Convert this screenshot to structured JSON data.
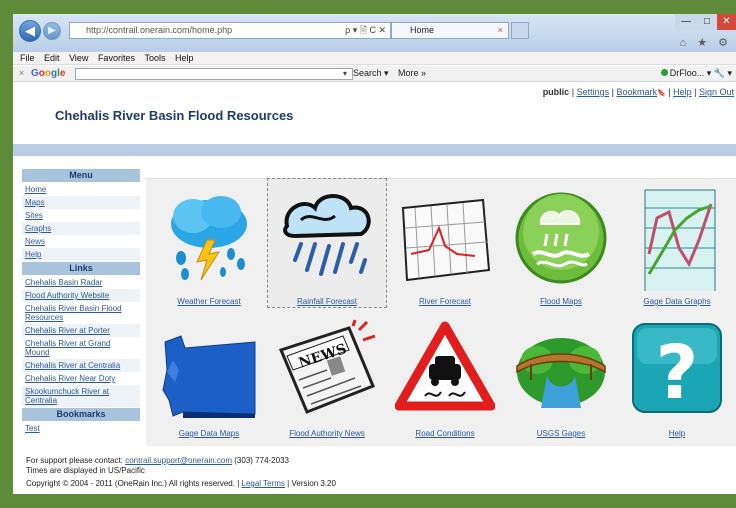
{
  "browser": {
    "url": "http://contrail.onerain.com/home.php",
    "addr_icons": "ρ ▾ 🗎 C ✕",
    "tab_title": "Home",
    "tab_close": "×",
    "back": "◀",
    "forward": "▶",
    "win_min": "—",
    "win_max": "□",
    "win_close": "✕",
    "tb_icons": "⌂ ★ ⚙"
  },
  "menubar": [
    "File",
    "Edit",
    "View",
    "Favorites",
    "Tools",
    "Help"
  ],
  "googlebar": {
    "close": "×",
    "logo": [
      "G",
      "o",
      "o",
      "g",
      "l",
      "e"
    ],
    "dropdown": "▾",
    "search_label": "Search ▾",
    "more_label": "More »",
    "user_label": "DrFloo... ▾",
    "wrench": "🔧 ▾"
  },
  "toplinks": {
    "public": "public",
    "sep": "|",
    "settings": "Settings",
    "bookmark": "Bookmark",
    "bookmark_icon": "🔖",
    "help": "Help",
    "signout": "Sign Out"
  },
  "site_title": "Chehalis River Basin Flood Resources",
  "sidebar": {
    "menu_heading": "Menu",
    "menu_items": [
      "Home",
      "Maps",
      "Sites",
      "Graphs",
      "News",
      "Help"
    ],
    "links_heading": "Links",
    "link_items": [
      "Chehalis Basin Radar",
      "Flood Authority Website",
      "Chehalis River Basin Flood Resources",
      "Chehalis River at Porter",
      "Chehalis River at Grand Mound",
      "Chehalis River at Centralia",
      "Chehalis River Near Doty",
      "Skookumchuck River at Centralia"
    ],
    "bookmarks_heading": "Bookmarks",
    "bookmark_items": [
      "Test"
    ]
  },
  "tiles": [
    {
      "label": "Weather Forecast",
      "icon": "weather-storm-icon"
    },
    {
      "label": "Rainfall Forecast",
      "icon": "rain-cloud-icon"
    },
    {
      "label": "River Forecast",
      "icon": "river-graph-icon"
    },
    {
      "label": "Flood Maps",
      "icon": "flood-map-icon"
    },
    {
      "label": "Gage Data Graphs",
      "icon": "gage-graph-icon"
    },
    {
      "label": "Gage Data Maps",
      "icon": "washington-map-icon"
    },
    {
      "label": "Flood Authority News",
      "icon": "newspaper-icon"
    },
    {
      "label": "Road Conditions",
      "icon": "slippery-road-sign-icon"
    },
    {
      "label": "USGS Gages",
      "icon": "bridge-river-icon"
    },
    {
      "label": "Help",
      "icon": "help-question-icon"
    }
  ],
  "footer": {
    "support_prefix": "For support please contact:",
    "support_email": "contrail.support@onerain.com",
    "support_phone": "(303) 774-2033",
    "timezone_note": "Times are displayed in US/Pacific",
    "copyright": "Copyright © 2004 - 2011 (OneRain Inc.) All rights reserved.",
    "legal_terms": "Legal Terms",
    "version": "Version 3.20"
  }
}
